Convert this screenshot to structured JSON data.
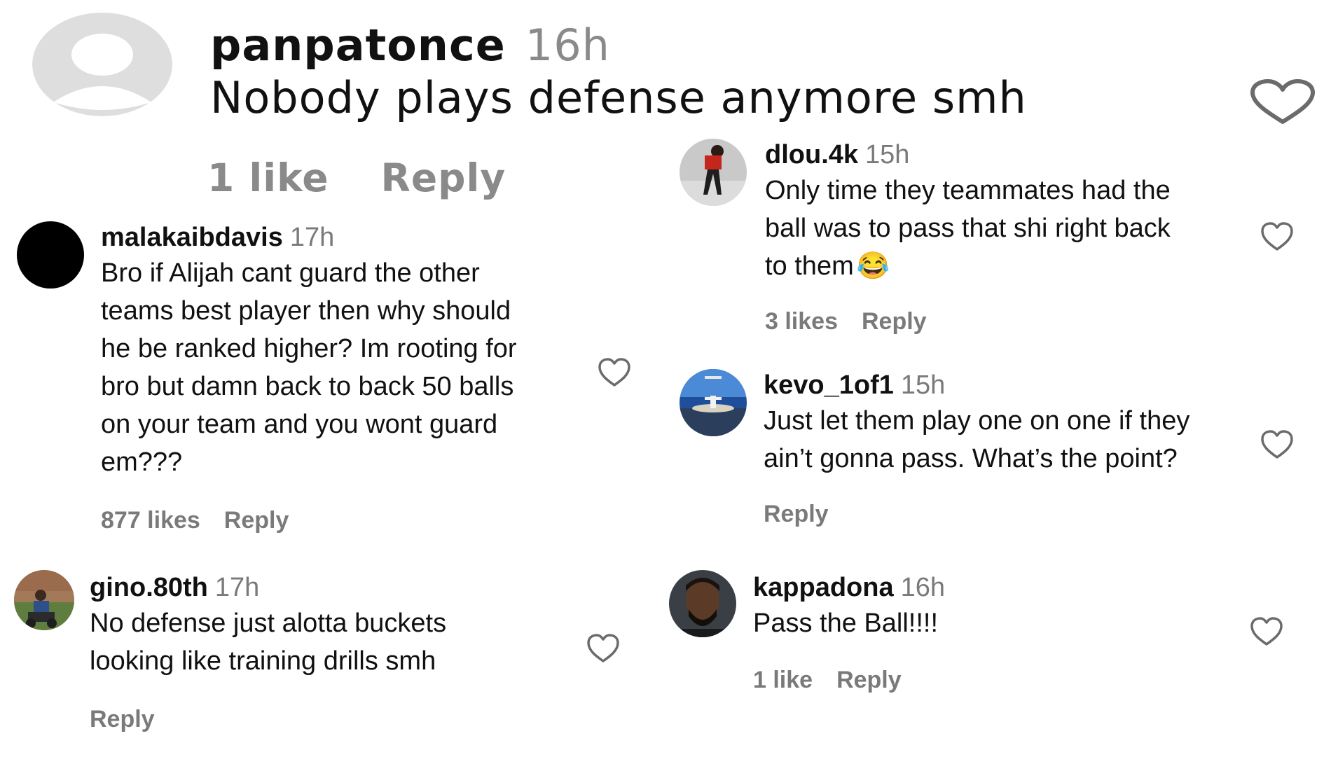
{
  "main_comment": {
    "username": "panpatonce",
    "time": "16h",
    "text": "Nobody plays defense anymore smh",
    "likes": "1 like",
    "reply": "Reply"
  },
  "replies": {
    "malakaibdavis": {
      "username": "malakaibdavis",
      "time": "17h",
      "lines": [
        "Bro if Alijah cant guard the other",
        "teams best player then why should",
        "he be ranked higher? Im rooting for",
        "bro but damn back to back 50 balls",
        "on your team and you wont guard",
        "em???"
      ],
      "likes": "877 likes",
      "reply": "Reply"
    },
    "gino": {
      "username": "gino.80th",
      "time": "17h",
      "lines": [
        "No defense just alotta buckets",
        "looking like training drills smh"
      ],
      "reply": "Reply"
    },
    "dlou": {
      "username": "dlou.4k",
      "time": "15h",
      "lines": [
        "Only time they teammates had the",
        "ball was to pass that shi right back",
        "to them"
      ],
      "emoji": "😂",
      "likes": "3 likes",
      "reply": "Reply"
    },
    "kevo": {
      "username": "kevo_1of1",
      "time": "15h",
      "lines": [
        "Just let them play one on one if they",
        "ain’t gonna pass. What’s the point?"
      ],
      "reply": "Reply"
    },
    "kappadona": {
      "username": "kappadona",
      "time": "16h",
      "lines": [
        "Pass the Ball!!!!"
      ],
      "likes": "1 like",
      "reply": "Reply"
    }
  },
  "colors": {
    "text": "#111111",
    "muted": "#7a7a7a",
    "heart_stroke": "#6b6b6b",
    "placeholder_avatar": "#dedede"
  }
}
